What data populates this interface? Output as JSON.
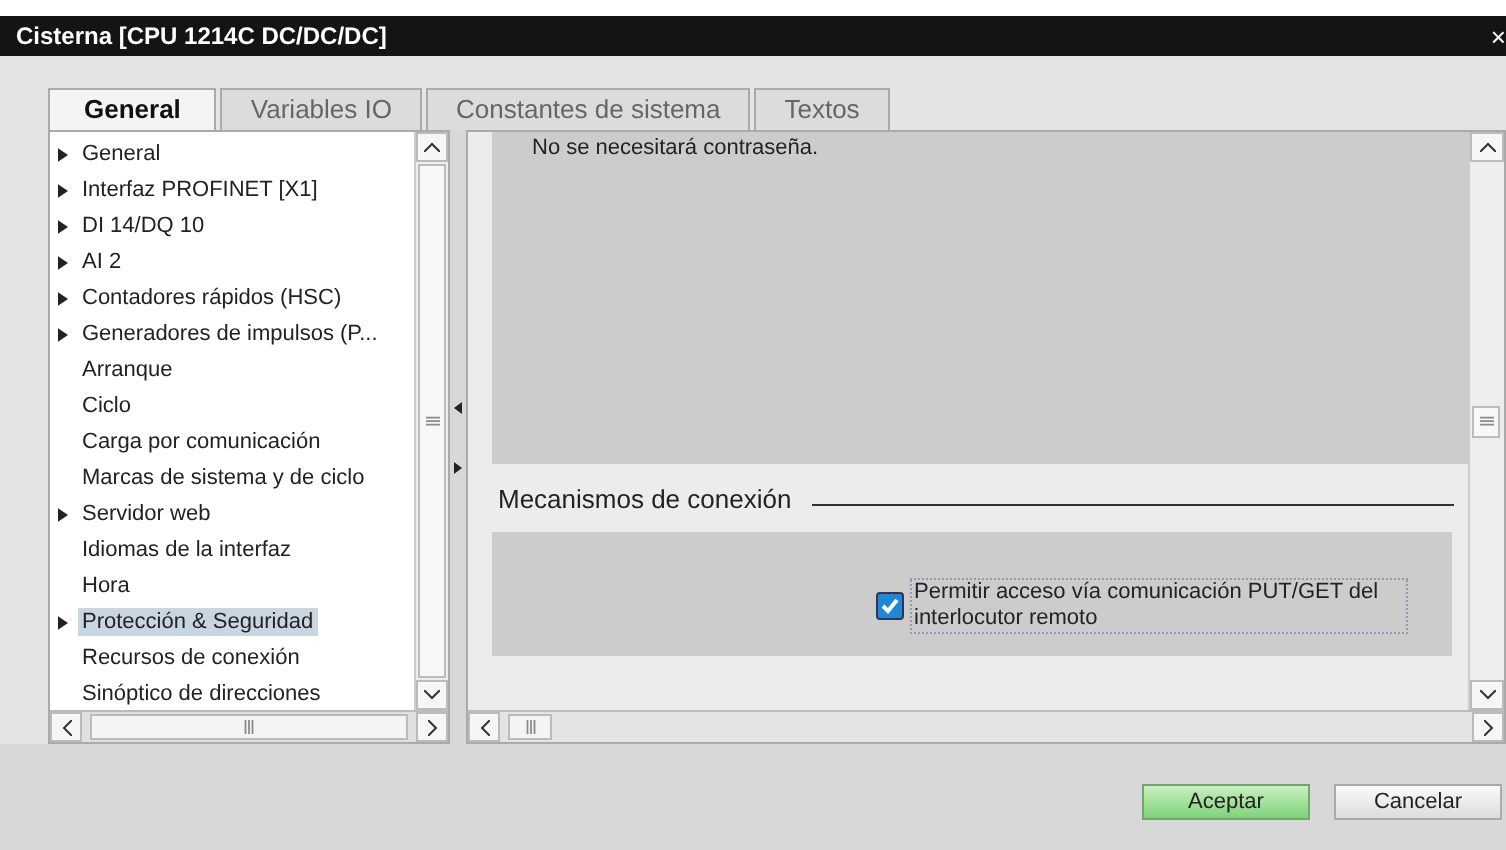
{
  "window": {
    "title": "Cisterna [CPU 1214C DC/DC/DC]",
    "close": "×"
  },
  "tabs": [
    {
      "label": "General",
      "selected": true
    },
    {
      "label": "Variables IO",
      "selected": false
    },
    {
      "label": "Constantes de sistema",
      "selected": false
    },
    {
      "label": "Textos",
      "selected": false
    }
  ],
  "sidebar": {
    "items": [
      {
        "label": "General",
        "expandable": true,
        "selected": false
      },
      {
        "label": "Interfaz PROFINET [X1]",
        "expandable": true,
        "selected": false
      },
      {
        "label": "DI 14/DQ 10",
        "expandable": true,
        "selected": false
      },
      {
        "label": "AI 2",
        "expandable": true,
        "selected": false
      },
      {
        "label": "Contadores rápidos (HSC)",
        "expandable": true,
        "selected": false
      },
      {
        "label": "Generadores de impulsos (P...",
        "expandable": true,
        "selected": false
      },
      {
        "label": "Arranque",
        "expandable": false,
        "selected": false
      },
      {
        "label": "Ciclo",
        "expandable": false,
        "selected": false
      },
      {
        "label": "Carga por comunicación",
        "expandable": false,
        "selected": false
      },
      {
        "label": "Marcas de sistema y de ciclo",
        "expandable": false,
        "selected": false
      },
      {
        "label": "Servidor web",
        "expandable": true,
        "selected": false
      },
      {
        "label": "Idiomas de la interfaz",
        "expandable": false,
        "selected": false
      },
      {
        "label": "Hora",
        "expandable": false,
        "selected": false
      },
      {
        "label": "Protección & Seguridad",
        "expandable": true,
        "selected": true
      },
      {
        "label": "Recursos de conexión",
        "expandable": false,
        "selected": false
      },
      {
        "label": "Sinóptico de direcciones",
        "expandable": false,
        "selected": false
      }
    ]
  },
  "content": {
    "note": "No se necesitará contraseña.",
    "section_title": "Mecanismos de conexión",
    "checkbox": {
      "label": "Permitir acceso vía comunicación PUT/GET del interlocutor remoto",
      "checked": true
    }
  },
  "buttons": [
    {
      "label": "Aceptar",
      "kind": "primary"
    },
    {
      "label": "Cancelar",
      "kind": "secondary"
    }
  ]
}
